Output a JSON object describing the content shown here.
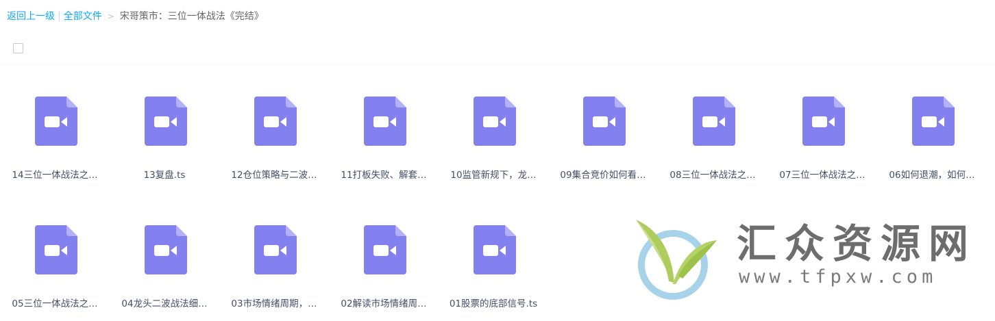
{
  "breadcrumb": {
    "back": "返回上一级",
    "separator": "|",
    "all_files": "全部文件",
    "arrow": ">",
    "current": "宋哥策市：三位一体战法《完结》"
  },
  "files": [
    {
      "name": "14三位一体战法之…",
      "icon": "video-file-icon"
    },
    {
      "name": "13复盘.ts",
      "icon": "video-file-icon"
    },
    {
      "name": "12仓位策略与二波…",
      "icon": "video-file-icon"
    },
    {
      "name": "11打板失败、解套…",
      "icon": "video-file-icon"
    },
    {
      "name": "10监管新规下，龙…",
      "icon": "video-file-icon"
    },
    {
      "name": "09集合竞价如何看…",
      "icon": "video-file-icon"
    },
    {
      "name": "08三位一体战法之…",
      "icon": "video-file-icon"
    },
    {
      "name": "07三位一体战法之…",
      "icon": "video-file-icon"
    },
    {
      "name": "06如何退潮，如何…",
      "icon": "video-file-icon"
    },
    {
      "name": "05三位一体战法之…",
      "icon": "video-file-icon"
    },
    {
      "name": "04龙头二波战法细…",
      "icon": "video-file-icon"
    },
    {
      "name": "03市场情绪周期，…",
      "icon": "video-file-icon"
    },
    {
      "name": "02解读市场情绪周…",
      "icon": "video-file-icon"
    },
    {
      "name": "01股票的底部信号.ts",
      "icon": "video-file-icon"
    }
  ],
  "watermark": {
    "title": "汇众资源网",
    "url": "www.tfpxw.com"
  },
  "colors": {
    "link": "#09aaff",
    "icon_fill": "#8381f0",
    "icon_fold": "#b3b1f8"
  }
}
